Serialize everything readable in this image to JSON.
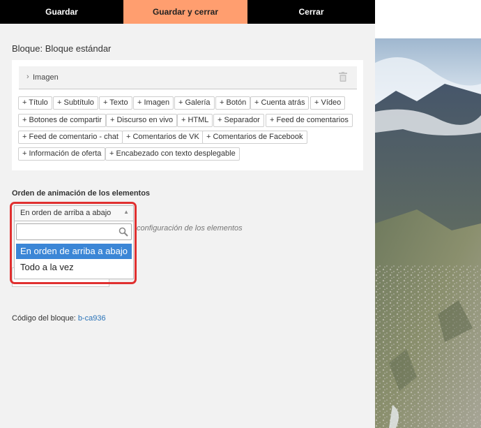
{
  "toolbar": {
    "save": "Guardar",
    "save_close": "Guardar y cerrar",
    "close": "Cerrar"
  },
  "block_title": "Bloque: Bloque estándar",
  "image_row": {
    "label": "Imagen"
  },
  "add_buttons": [
    "+ Título",
    "+ Subtítulo",
    "+ Texto",
    "+ Imagen",
    "+ Galería",
    "+ Botón",
    "+ Cuenta atrás",
    "+ Vídeo",
    "+ Botones de compartir",
    "+ Discurso en vivo",
    "+ HTML",
    "+ Separador",
    "+ Feed de comentarios",
    "+ Feed de comentario - chat",
    "+ Comentarios de VK",
    "+ Comentarios de Facebook",
    "+ Información de oferta",
    "+ Encabezado con texto desplegable"
  ],
  "animation": {
    "label": "Orden de animación de los elementos",
    "selected": "En orden de arriba a abajo",
    "options": [
      "En orden de arriba a abajo",
      "Todo a la vez"
    ],
    "hint": "configuración de los elementos"
  },
  "block_code": {
    "label": "Código del bloque:",
    "value": "b-ca936"
  },
  "colors": {
    "accent": "#ff9e6f",
    "toolbar": "#000000",
    "selection": "#3b86d6",
    "highlight": "#e03030",
    "link": "#2a73b8"
  }
}
